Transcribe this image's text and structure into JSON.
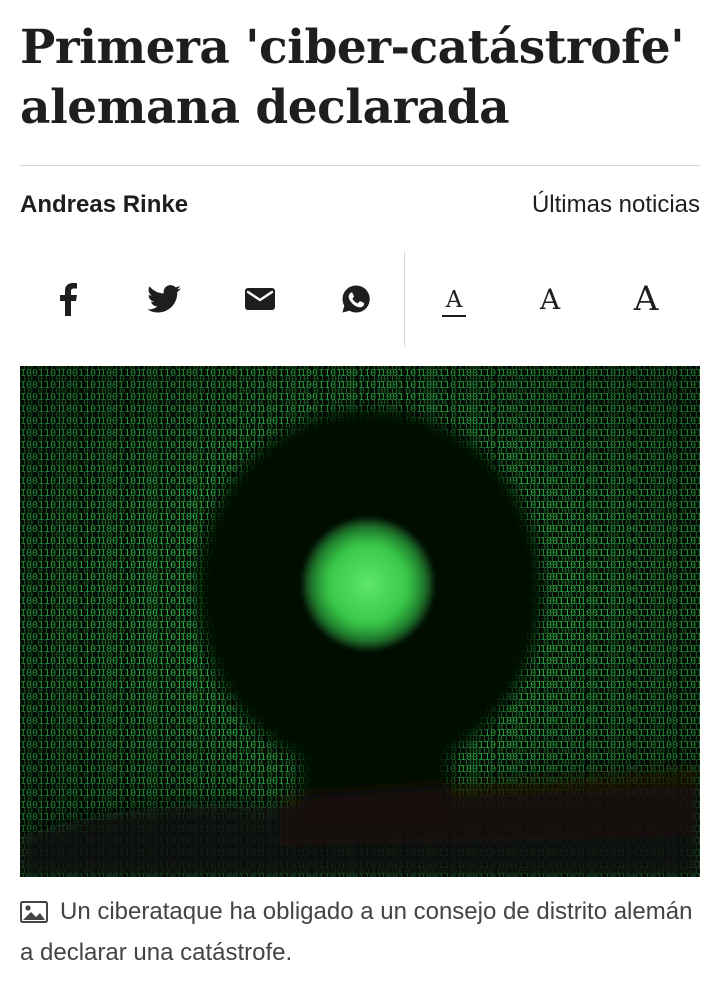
{
  "article": {
    "title": "Primera 'ciber-catástrofe' alemana declarada",
    "author": "Andreas Rinke",
    "section": "Últimas noticias"
  },
  "share": {
    "icons": [
      "facebook-icon",
      "twitter-icon",
      "email-icon",
      "whatsapp-icon"
    ]
  },
  "font_size": {
    "small": "A",
    "medium": "A",
    "large": "A"
  },
  "image": {
    "caption": "Un ciberataque ha obligado a un consejo de distrito alemán a declarar una catástrofe."
  },
  "colors": {
    "text": "#1e1e1e",
    "caption": "#444444",
    "rule": "#d8d8d8",
    "matrix_green": "#39e35c"
  }
}
